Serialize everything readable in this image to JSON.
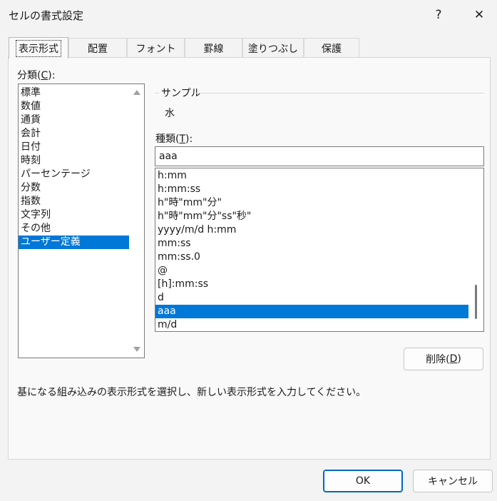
{
  "window": {
    "title": "セルの書式設定",
    "help": "?",
    "close": "✕"
  },
  "tabs": [
    {
      "label": "表示形式",
      "active": true
    },
    {
      "label": "配置"
    },
    {
      "label": "フォント"
    },
    {
      "label": "罫線"
    },
    {
      "label": "塗りつぶし"
    },
    {
      "label": "保護"
    }
  ],
  "category": {
    "label_prefix": "分類(",
    "label_key": "C",
    "label_suffix": "):",
    "items": [
      "標準",
      "数値",
      "通貨",
      "会計",
      "日付",
      "時刻",
      "パーセンテージ",
      "分数",
      "指数",
      "文字列",
      "その他",
      "ユーザー定義"
    ],
    "selected": "ユーザー定義"
  },
  "sample": {
    "label": "サンプル",
    "value": "水"
  },
  "type": {
    "label_prefix": "種類(",
    "label_key": "T",
    "label_suffix": "):",
    "input_value": "aaa",
    "items": [
      "h:mm",
      "h:mm:ss",
      "h\"時\"mm\"分\"",
      "h\"時\"mm\"分\"ss\"秒\"",
      "yyyy/m/d h:mm",
      "mm:ss",
      "mm:ss.0",
      "@",
      "[h]:mm:ss",
      "d",
      "aaa",
      "m/d"
    ],
    "selected": "aaa"
  },
  "delete_button": {
    "label_prefix": "削除(",
    "label_key": "D",
    "label_suffix": ")"
  },
  "description": "基になる組み込みの表示形式を選択し、新しい表示形式を入力してください。",
  "footer": {
    "ok": "OK",
    "cancel": "キャンセル"
  },
  "colors": {
    "selection": "#0078d7",
    "dialog_bg": "#f3f3f3",
    "panel_bg": "#f9f9f9",
    "primary_border": "#0067c0"
  }
}
